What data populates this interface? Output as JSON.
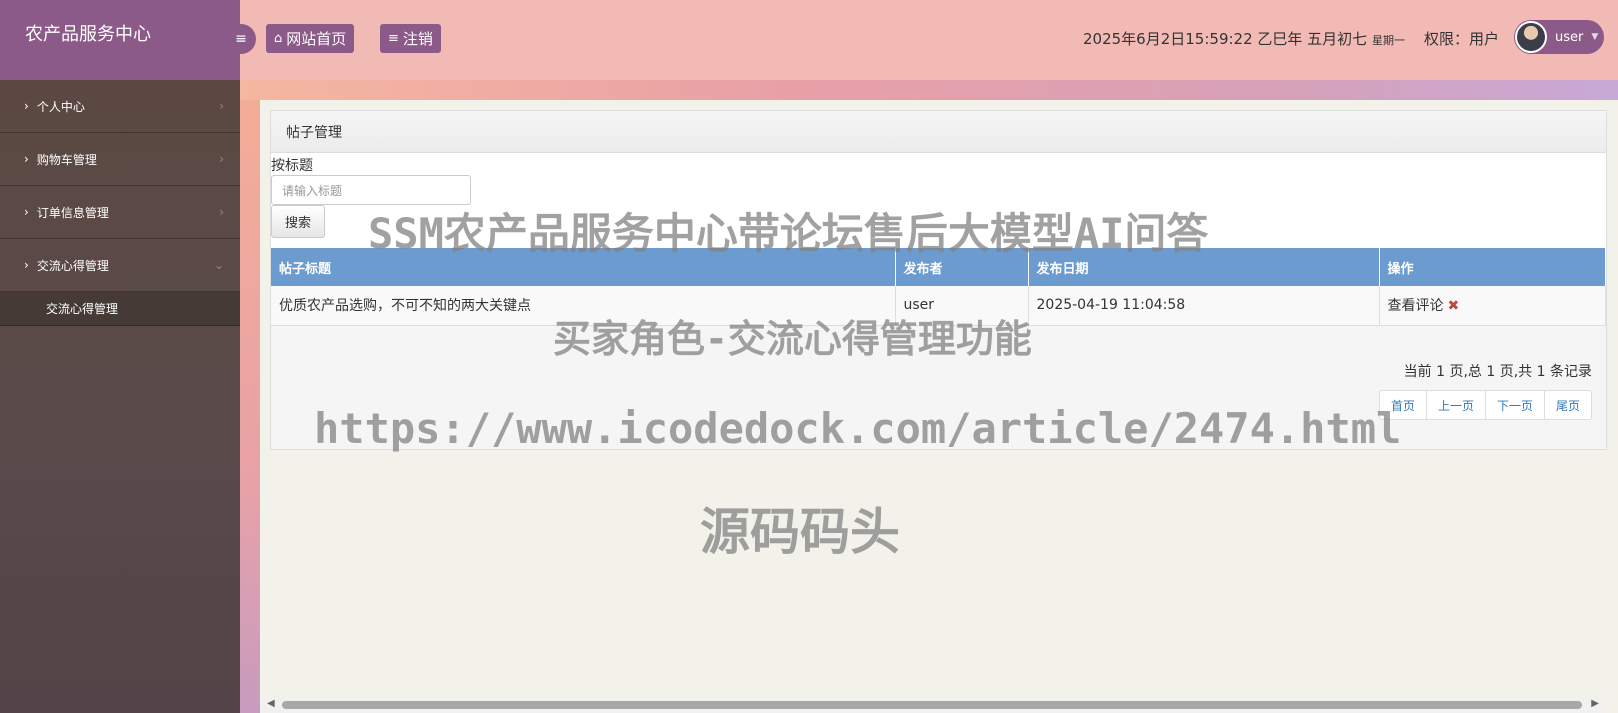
{
  "app": {
    "brand": "农产品服务中心"
  },
  "sidebar": {
    "items": [
      {
        "label": "个人中心"
      },
      {
        "label": "购物车管理"
      },
      {
        "label": "订单信息管理"
      },
      {
        "label": "交流心得管理"
      }
    ],
    "submenu": [
      {
        "label": "交流心得管理"
      }
    ]
  },
  "header": {
    "home_btn": "网站首页",
    "logout_btn": "注销",
    "datetime": "2025年6月2日15:59:22 乙巳年 五月初七",
    "weekday": "星期一",
    "permission": "权限：用户",
    "username": "user"
  },
  "panel": {
    "title": "帖子管理",
    "search_label": "按标题",
    "search_placeholder": "请输入标题",
    "search_btn": "搜索"
  },
  "table": {
    "columns": [
      "帖子标题",
      "发布者",
      "发布日期",
      "操作"
    ],
    "rows": [
      {
        "title": "优质农产品选购，不可不知的两大关键点",
        "author": "user",
        "date": "2025-04-19 11:04:58",
        "action": "查看评论"
      }
    ]
  },
  "pagination": {
    "info": "当前 1 页,总 1 页,共 1 条记录",
    "first": "首页",
    "prev": "上一页",
    "next": "下一页",
    "last": "尾页"
  },
  "watermarks": {
    "line1": "SSM农产品服务中心带论坛售后大模型AI问答",
    "line2": "买家角色-交流心得管理功能",
    "line3": "https://www.icodedock.com/article/2474.html",
    "line4": "源码码头"
  },
  "colors": {
    "accent": "#8c5a88",
    "header_bg": "#f2bab4",
    "table_head": "#6c9bcf"
  }
}
